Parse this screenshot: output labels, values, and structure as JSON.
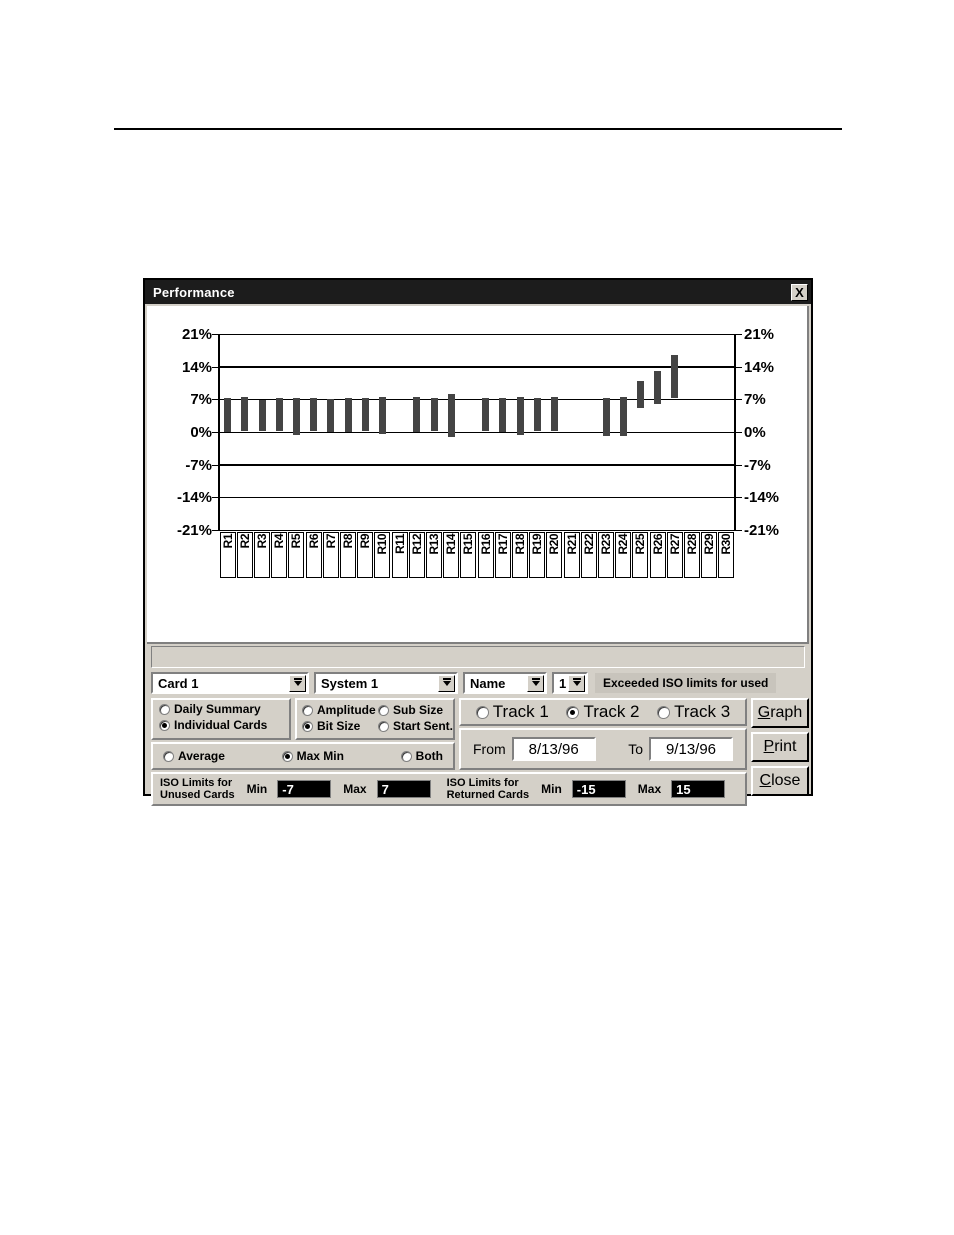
{
  "window": {
    "title": "Performance",
    "close_icon": "close-icon",
    "close_label": "X"
  },
  "chart_data": {
    "type": "bar",
    "title": "",
    "xlabel": "",
    "ylabel": "",
    "ylim": [
      -21,
      21
    ],
    "ytick_values": [
      21,
      14,
      7,
      0,
      -7,
      -14,
      -21
    ],
    "ytick_labels": [
      "21%",
      "14%",
      "7%",
      "0%",
      "-7%",
      "-14%",
      "-21%"
    ],
    "right_axis_labels": [
      "21%",
      "14%",
      "7%",
      "0%",
      "-7%",
      "-14%",
      "-21%"
    ],
    "grid": true,
    "emphasized_gridlines": [
      14,
      -7
    ],
    "legend": "none",
    "bar_style": "max-min floating range bars",
    "categories": [
      "R1",
      "R2",
      "R3",
      "R4",
      "R5",
      "R6",
      "R7",
      "R8",
      "R9",
      "R10",
      "R11",
      "R12",
      "R13",
      "R14",
      "R15",
      "R16",
      "R17",
      "R18",
      "R19",
      "R20",
      "R21",
      "R22",
      "R23",
      "R24",
      "R25",
      "R26",
      "R27",
      "R28",
      "R29",
      "R30"
    ],
    "series": [
      {
        "name": "Max",
        "values": [
          7.2,
          7.4,
          6.9,
          7.2,
          7.2,
          7.2,
          7.0,
          7.2,
          7.2,
          7.4,
          null,
          7.4,
          7.2,
          8.2,
          null,
          7.2,
          7.2,
          7.6,
          7.2,
          7.4,
          null,
          null,
          7.2,
          7.4,
          11.0,
          13.0,
          16.5,
          null,
          null,
          null
        ]
      },
      {
        "name": "Min",
        "values": [
          0.1,
          0.2,
          0.2,
          0.2,
          -0.6,
          0.2,
          0.1,
          0.1,
          0.2,
          -0.4,
          null,
          0.1,
          0.2,
          -1.1,
          null,
          0.2,
          0.1,
          -0.6,
          0.2,
          0.2,
          null,
          null,
          -0.9,
          -0.9,
          5.2,
          6.0,
          7.2,
          null,
          null,
          null
        ]
      }
    ]
  },
  "status_strip": {
    "text": ""
  },
  "selectors": {
    "card": {
      "value": "Card 1",
      "arrow_icon": "spinner-down-icon"
    },
    "system": {
      "value": "System 1",
      "arrow_icon": "spinner-down-icon"
    },
    "name": {
      "value": "Name",
      "arrow_icon": "spinner-down-icon"
    },
    "number": {
      "value": "1",
      "arrow_icon": "spinner-down-icon"
    },
    "iso_message": "Exceeded ISO limits for used"
  },
  "summary_group": {
    "options": [
      {
        "label": "Daily Summary",
        "selected": false
      },
      {
        "label": "Individual Cards",
        "selected": true
      }
    ]
  },
  "size_group": {
    "options": [
      {
        "label": "Amplitude",
        "selected": false
      },
      {
        "label": "Sub Size",
        "selected": false
      },
      {
        "label": "Bit Size",
        "selected": true
      },
      {
        "label": "Start Sent.",
        "selected": false
      }
    ]
  },
  "average_group": {
    "options": [
      {
        "label": "Average",
        "selected": false
      },
      {
        "label": "Max Min",
        "selected": true
      },
      {
        "label": "Both",
        "selected": false
      }
    ]
  },
  "track_group": {
    "options": [
      {
        "label": "Track 1",
        "selected": false
      },
      {
        "label": "Track 2",
        "selected": true
      },
      {
        "label": "Track 3",
        "selected": false
      }
    ]
  },
  "date_range": {
    "from_label": "From",
    "from_value": "8/13/96",
    "to_label": "To",
    "to_value": "9/13/96"
  },
  "iso_limits": {
    "unused": {
      "title_line1": "ISO Limits for",
      "title_line2": "Unused Cards",
      "min_label": "Min",
      "min_value": "-7",
      "max_label": "Max",
      "max_value": "7"
    },
    "returned": {
      "title_line1": "ISO Limits for",
      "title_line2": "Returned Cards",
      "min_label": "Min",
      "min_value": "-15",
      "max_label": "Max",
      "max_value": "15"
    }
  },
  "buttons": {
    "graph": {
      "mnemonic": "G",
      "rest": "raph"
    },
    "print": {
      "mnemonic": "P",
      "rest": "rint"
    },
    "close": {
      "mnemonic": "C",
      "rest": "lose"
    }
  }
}
